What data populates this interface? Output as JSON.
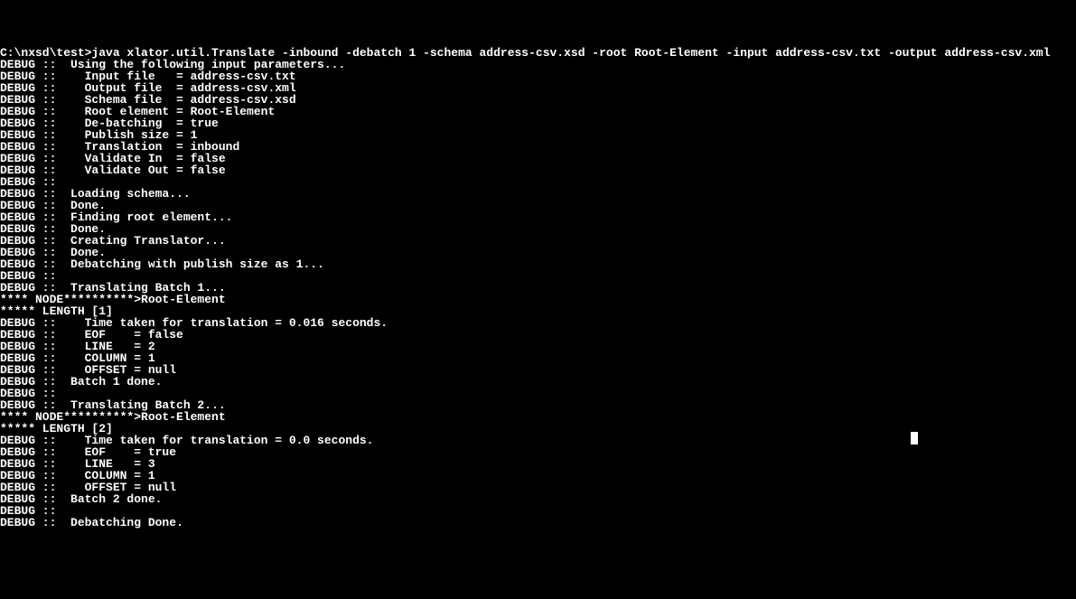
{
  "terminal": {
    "prompt": "C:\\nxsd\\test>",
    "command": "java xlator.util.Translate -inbound -debatch 1 -schema address-csv.xsd -root Root-Element -input address-csv.txt -output address-csv.xml",
    "lines": [
      "DEBUG ::  Using the following input parameters...",
      "DEBUG ::    Input file   = address-csv.txt",
      "DEBUG ::    Output file  = address-csv.xml",
      "DEBUG ::    Schema file  = address-csv.xsd",
      "DEBUG ::    Root element = Root-Element",
      "DEBUG ::    De-batching  = true",
      "DEBUG ::    Publish size = 1",
      "DEBUG ::    Translation  = inbound",
      "DEBUG ::    Validate In  = false",
      "DEBUG ::    Validate Out = false",
      "DEBUG :: ",
      "DEBUG ::  Loading schema...",
      "DEBUG ::  Done.",
      "DEBUG ::  Finding root element...",
      "DEBUG ::  Done.",
      "DEBUG ::  Creating Translator...",
      "DEBUG ::  Done.",
      "DEBUG ::  Debatching with publish size as 1...",
      "DEBUG :: ",
      "DEBUG ::  Translating Batch 1...",
      "**** NODE**********>Root-Element",
      "***** LENGTH [1]",
      "DEBUG ::    Time taken for translation = 0.016 seconds.",
      "DEBUG ::    EOF    = false",
      "DEBUG ::    LINE   = 2",
      "DEBUG ::    COLUMN = 1",
      "DEBUG ::    OFFSET = null",
      "DEBUG ::  Batch 1 done.",
      "DEBUG :: ",
      "DEBUG ::  Translating Batch 2...",
      "**** NODE**********>Root-Element",
      "***** LENGTH [2]",
      "DEBUG ::    Time taken for translation = 0.0 seconds.",
      "DEBUG ::    EOF    = true",
      "DEBUG ::    LINE   = 3",
      "DEBUG ::    COLUMN = 1",
      "DEBUG ::    OFFSET = null",
      "DEBUG ::  Batch 2 done.",
      "DEBUG :: ",
      "DEBUG ::  Debatching Done."
    ]
  }
}
